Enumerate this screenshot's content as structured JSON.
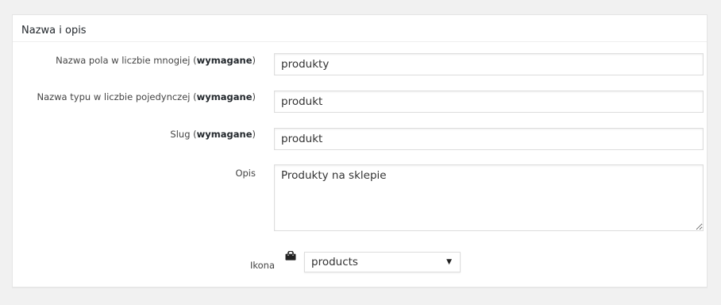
{
  "panel": {
    "title": "Nazwa i opis"
  },
  "fields": {
    "plural": {
      "label": "Nazwa pola w liczbie mnogiej",
      "required": "wymagane",
      "value": "produkty"
    },
    "singular": {
      "label": "Nazwa typu w liczbie pojedynczej",
      "required": "wymagane",
      "value": "produkt"
    },
    "slug": {
      "label": "Slug",
      "required": "wymagane",
      "value": "produkt"
    },
    "description": {
      "label": "Opis",
      "value": "Produkty na sklepie"
    },
    "icon": {
      "label": "Ikona",
      "icon_name": "products-bag-icon",
      "selected": "products"
    }
  }
}
